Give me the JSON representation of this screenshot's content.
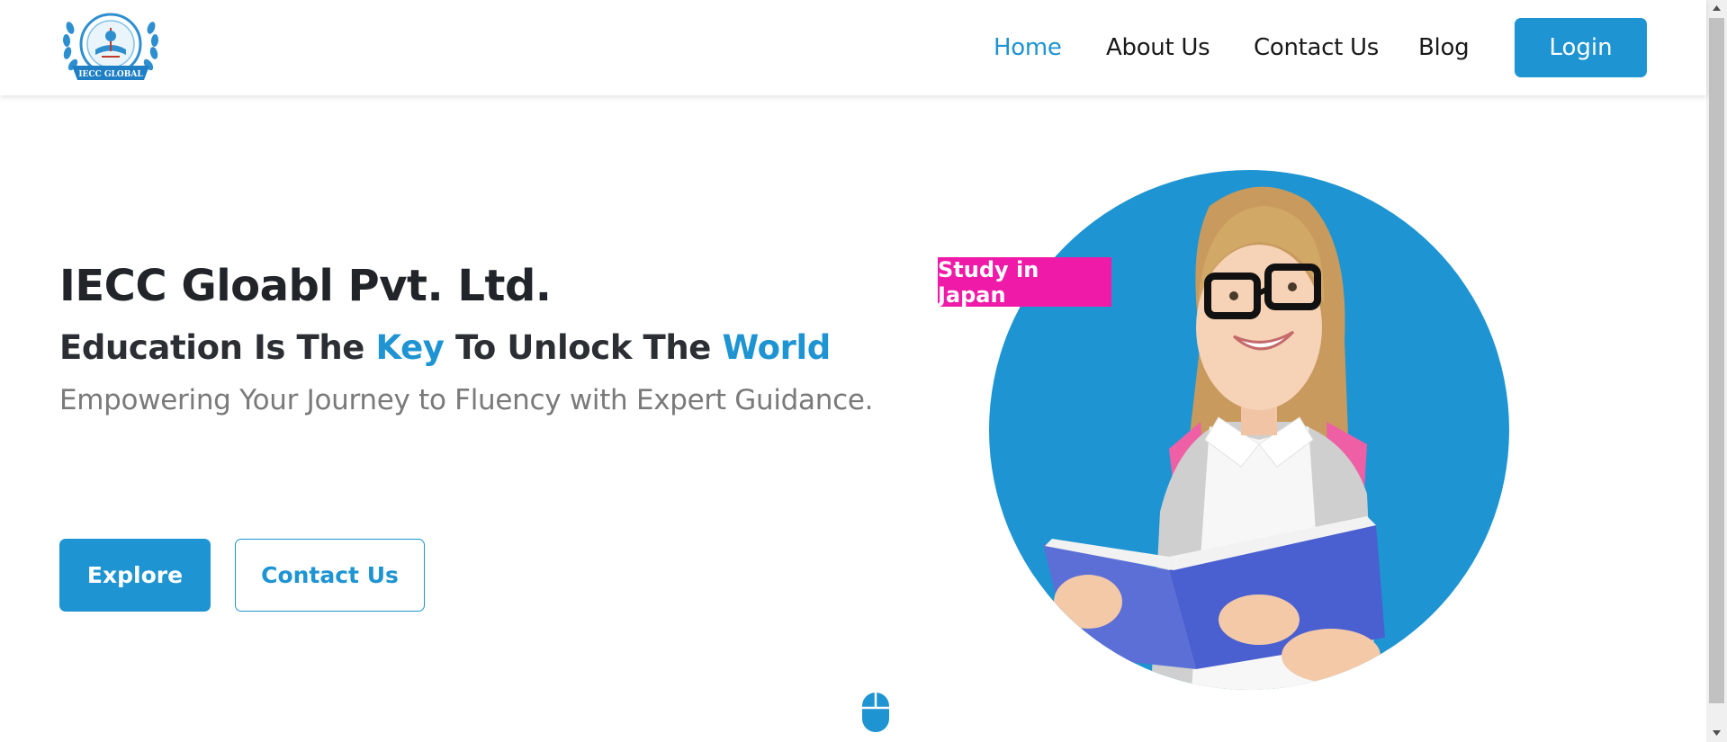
{
  "brand": {
    "logo_text": "IECC GLOBAL",
    "primary_color": "#1e94d2",
    "accent_color": "#f01aa8"
  },
  "nav": {
    "items": [
      {
        "label": "Home",
        "active": true
      },
      {
        "label": "About Us",
        "active": false
      },
      {
        "label": "Contact Us",
        "active": false
      },
      {
        "label": "Blog",
        "active": false
      }
    ],
    "login_label": "Login"
  },
  "hero": {
    "company_name": "IECC Gloabl Pvt. Ltd.",
    "tagline_part1": "Education Is The ",
    "tagline_highlight1": "Key",
    "tagline_part2": " To Unlock The ",
    "tagline_highlight2": "World",
    "subtitle": "Empowering Your Journey to Fluency with Expert Guidance.",
    "explore_label": "Explore",
    "contact_label": "Contact Us",
    "badge_text": "Study in Japan",
    "image_icon": "student-with-book-photo"
  },
  "scroll_indicator_icon": "mouse-scroll-icon"
}
